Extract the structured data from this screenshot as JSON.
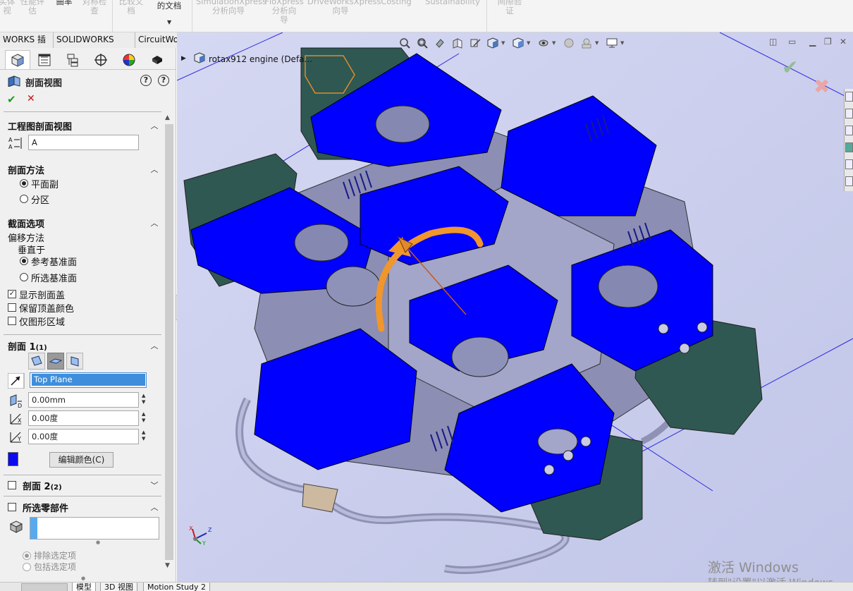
{
  "ribbon": {
    "items": [
      {
        "label": "实体\n视",
        "muted": true
      },
      {
        "label": "性能评\n估",
        "muted": true
      },
      {
        "label": "曲率",
        "muted": false
      },
      {
        "label": "对称检\n查",
        "muted": true
      },
      {
        "label": "比较文\n档",
        "muted": true
      },
      {
        "label": "的文档",
        "muted": false
      },
      {
        "label": "SimulationXpress\n分析向导",
        "muted": true
      },
      {
        "label": "FloXpress\n分析向\n导",
        "muted": true
      },
      {
        "label": "DriveWorksXpress\n向导",
        "muted": true
      },
      {
        "label": "Costing",
        "muted": true
      },
      {
        "label": "Sustainability",
        "muted": true
      },
      {
        "label": "间隙验\n证",
        "muted": true
      }
    ]
  },
  "command_tabs": [
    "WORKS 插件",
    "SOLIDWORKS MBD",
    "CircuitWorks"
  ],
  "manager_tabs": [
    {
      "name": "featuremanager-tab",
      "icon": "cube-icon",
      "active": true
    },
    {
      "name": "propertymanager-tab",
      "icon": "property-list-icon",
      "active": false
    },
    {
      "name": "configurationmanager-tab",
      "icon": "configuration-icon",
      "active": false
    },
    {
      "name": "dimxpertmanager-tab",
      "icon": "crosshair-icon",
      "active": false
    },
    {
      "name": "displaymanager-tab",
      "icon": "color-wheel-icon",
      "active": false
    },
    {
      "name": "camera-tab",
      "icon": "camera-icon",
      "active": false
    }
  ],
  "property_manager": {
    "title": "剖面视图",
    "help_label": "?",
    "drawing_section": {
      "header": "工程图剖面视图",
      "name_value": "A"
    },
    "section_method": {
      "header": "剖面方法",
      "options": [
        {
          "label": "平面副",
          "selected": true
        },
        {
          "label": "分区",
          "selected": false
        }
      ]
    },
    "section_options": {
      "header": "截面选项",
      "offset_label": "偏移方法",
      "normal_label": "垂直于",
      "radios": [
        {
          "label": "参考基准面",
          "selected": true
        },
        {
          "label": "所选基准面",
          "selected": false
        }
      ],
      "checks": [
        {
          "label": "显示剖面盖",
          "checked": true
        },
        {
          "label": "保留顶盖颜色",
          "checked": false
        },
        {
          "label": "仅图形区域",
          "checked": false
        }
      ]
    },
    "section1": {
      "header": "剖面 1",
      "header_suffix": "(1)",
      "plane_value": "Top Plane",
      "offset_value": "0.00mm",
      "angle_x_value": "0.00度",
      "angle_y_value": "0.00度",
      "cap_color": "#0b0bef",
      "edit_color_label": "编辑颜色(C)"
    },
    "section2": {
      "header": "剖面 2",
      "header_suffix": "(2)"
    },
    "selected_components": {
      "header": "所选零部件",
      "options": [
        {
          "label": "排除选定项",
          "selected": true
        },
        {
          "label": "包括选定项",
          "selected": false
        }
      ]
    }
  },
  "viewport": {
    "tree_label": "rotax912 engine  (Defa...",
    "watermark_line1": "激活 Windows",
    "watermark_line2": "转到\"设置\"以激活 Windows。",
    "triad_labels": {
      "x": "X",
      "y": "Y",
      "z": "Z"
    },
    "section_cap_color": "#0000ff",
    "background_color": "#cfd2ee",
    "rotation_arrow_color": "#f0962c"
  },
  "bottom_tabs": [
    {
      "label": "模型",
      "active": true
    },
    {
      "label": "3D 视图",
      "active": false
    },
    {
      "label": "Motion Study 2",
      "active": false
    }
  ]
}
